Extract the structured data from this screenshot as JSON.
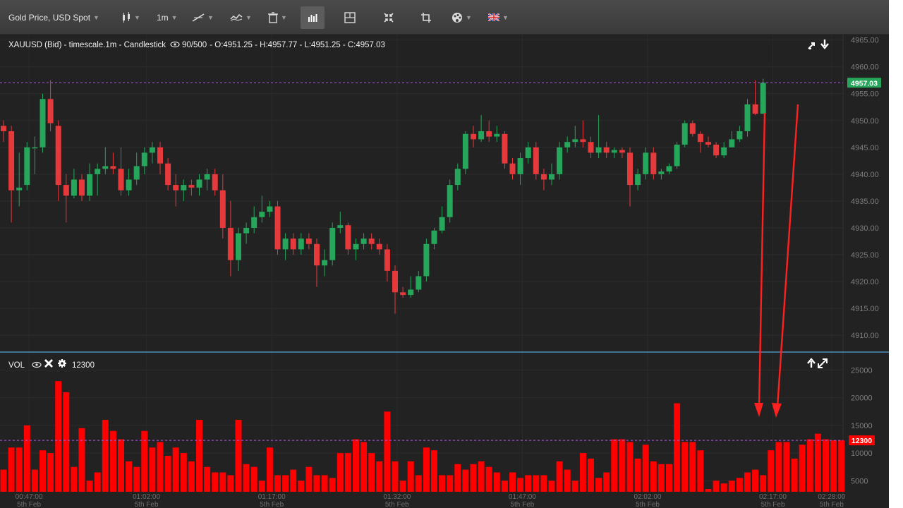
{
  "toolbar": {
    "symbol_label": "Gold Price, USD Spot",
    "timeframe_label": "1m"
  },
  "price_panel": {
    "header": "XAUUSD (Bid) - timescale.1m - Candlestick",
    "visible_count": "90/500",
    "ohlc": "- O:4951.25 - H:4957.77 - L:4951.25 - C:4957.03",
    "last_price_label": "4957.03"
  },
  "volume_panel": {
    "name": "VOL",
    "value": "12300",
    "last_value_label": "12300"
  },
  "colors": {
    "up": "#26a65b",
    "down": "#e5393c",
    "volume": "#ff0000",
    "last_line": "#a45ed6",
    "separator": "#5aa6d9",
    "arrow": "#ff2020"
  },
  "chart_data": [
    {
      "type": "candlestick",
      "title": "XAUUSD (Bid) - timescale.1m - Candlestick",
      "ylim": [
        4907,
        4966
      ],
      "yticks": [
        4910,
        4915,
        4920,
        4925,
        4930,
        4935,
        4940,
        4945,
        4950,
        4955,
        4960,
        4965
      ],
      "ytick_labels": [
        "4910.00",
        "4915.00",
        "4920.00",
        "4925.00",
        "4930.00",
        "4935.00",
        "4940.00",
        "4945.00",
        "4950.00",
        "4955.00",
        "4960.00",
        "4965.00"
      ],
      "last_price": 4957.03,
      "candles": [
        [
          4949.0,
          4950.0,
          4946.0,
          4948.0
        ],
        [
          4948.0,
          4949.0,
          4931.0,
          4937.0
        ],
        [
          4937.0,
          4944.0,
          4934.0,
          4937.5
        ],
        [
          4938.0,
          4946.0,
          4937.0,
          4945.0
        ],
        [
          4945.0,
          4947.0,
          4940.0,
          4945.0
        ],
        [
          4945.0,
          4955.0,
          4944.0,
          4954.0
        ],
        [
          4954.0,
          4957.5,
          4948.0,
          4949.5
        ],
        [
          4949.0,
          4950.0,
          4935.0,
          4938.0
        ],
        [
          4938.0,
          4940.0,
          4931.0,
          4936.0
        ],
        [
          4936.0,
          4941.0,
          4935.5,
          4939.0
        ],
        [
          4939.0,
          4940.0,
          4935.0,
          4936.0
        ],
        [
          4936.0,
          4942.0,
          4935.0,
          4940.0
        ],
        [
          4940.0,
          4942.0,
          4936.0,
          4941.0
        ],
        [
          4941.0,
          4945.0,
          4940.0,
          4941.5
        ],
        [
          4941.5,
          4944.0,
          4940.0,
          4941.0
        ],
        [
          4941.0,
          4945.0,
          4936.0,
          4937.0
        ],
        [
          4937.0,
          4941.0,
          4936.0,
          4939.0
        ],
        [
          4939.0,
          4944.0,
          4938.0,
          4941.5
        ],
        [
          4941.5,
          4945.0,
          4940.0,
          4944.0
        ],
        [
          4944.0,
          4946.0,
          4942.0,
          4945.0
        ],
        [
          4945.0,
          4946.0,
          4940.0,
          4942.0
        ],
        [
          4942.0,
          4943.0,
          4937.0,
          4938.0
        ],
        [
          4938.0,
          4940.0,
          4934.0,
          4937.0
        ],
        [
          4937.0,
          4939.0,
          4935.0,
          4938.0
        ],
        [
          4938.0,
          4939.0,
          4936.0,
          4937.5
        ],
        [
          4937.5,
          4940.0,
          4936.0,
          4939.0
        ],
        [
          4939.0,
          4941.0,
          4937.0,
          4940.0
        ],
        [
          4940.0,
          4941.0,
          4936.0,
          4937.0
        ],
        [
          4937.0,
          4940.0,
          4928.0,
          4930.0
        ],
        [
          4930.0,
          4935.0,
          4921.0,
          4924.0
        ],
        [
          4924.0,
          4930.0,
          4922.0,
          4929.0
        ],
        [
          4929.0,
          4931.0,
          4927.0,
          4930.0
        ],
        [
          4930.0,
          4934.0,
          4929.0,
          4932.0
        ],
        [
          4932.0,
          4936.0,
          4931.0,
          4933.0
        ],
        [
          4933.0,
          4935.0,
          4932.0,
          4934.0
        ],
        [
          4934.0,
          4935.0,
          4925.0,
          4926.0
        ],
        [
          4926.0,
          4929.0,
          4924.0,
          4928.0
        ],
        [
          4928.0,
          4929.0,
          4925.0,
          4926.0
        ],
        [
          4926.0,
          4929.0,
          4925.0,
          4928.0
        ],
        [
          4928.0,
          4929.0,
          4926.0,
          4927.0
        ],
        [
          4927.0,
          4928.0,
          4919.0,
          4923.0
        ],
        [
          4923.0,
          4926.0,
          4921.0,
          4924.0
        ],
        [
          4924.0,
          4931.0,
          4923.0,
          4930.0
        ],
        [
          4930.0,
          4933.0,
          4929.0,
          4930.5
        ],
        [
          4930.5,
          4931.0,
          4925.0,
          4926.0
        ],
        [
          4926.0,
          4928.0,
          4924.0,
          4927.0
        ],
        [
          4927.0,
          4929.0,
          4926.0,
          4928.0
        ],
        [
          4928.0,
          4929.0,
          4926.0,
          4927.0
        ],
        [
          4927.0,
          4928.0,
          4925.0,
          4926.0
        ],
        [
          4926.0,
          4927.0,
          4920.0,
          4922.0
        ],
        [
          4922.0,
          4923.0,
          4914.0,
          4918.0
        ],
        [
          4918.0,
          4919.0,
          4917.0,
          4917.5
        ],
        [
          4917.5,
          4921.0,
          4917.0,
          4918.5
        ],
        [
          4918.5,
          4922.0,
          4918.0,
          4921.0
        ],
        [
          4921.0,
          4928.0,
          4920.0,
          4927.0
        ],
        [
          4927.0,
          4930.0,
          4926.0,
          4929.5
        ],
        [
          4929.5,
          4934.0,
          4929.0,
          4932.0
        ],
        [
          4932.0,
          4939.0,
          4931.0,
          4938.0
        ],
        [
          4938.0,
          4942.0,
          4937.0,
          4941.0
        ],
        [
          4941.0,
          4948.0,
          4940.0,
          4947.5
        ],
        [
          4947.5,
          4949.0,
          4945.0,
          4946.5
        ],
        [
          4946.5,
          4951.0,
          4946.0,
          4948.0
        ],
        [
          4948.0,
          4950.0,
          4946.0,
          4947.0
        ],
        [
          4947.0,
          4949.0,
          4946.0,
          4947.5
        ],
        [
          4947.5,
          4948.0,
          4941.0,
          4942.0
        ],
        [
          4942.0,
          4943.0,
          4939.0,
          4940.0
        ],
        [
          4940.0,
          4944.0,
          4938.0,
          4943.0
        ],
        [
          4943.0,
          4946.0,
          4942.0,
          4945.0
        ],
        [
          4945.0,
          4946.0,
          4939.0,
          4940.0
        ],
        [
          4940.0,
          4941.0,
          4937.0,
          4939.0
        ],
        [
          4939.0,
          4942.0,
          4938.0,
          4940.0
        ],
        [
          4940.0,
          4946.0,
          4939.0,
          4945.0
        ],
        [
          4945.0,
          4947.0,
          4944.0,
          4946.0
        ],
        [
          4946.0,
          4949.0,
          4945.0,
          4946.5
        ],
        [
          4946.5,
          4950.0,
          4945.0,
          4946.0
        ],
        [
          4946.0,
          4947.0,
          4943.0,
          4944.0
        ],
        [
          4944.0,
          4951.0,
          4943.0,
          4945.0
        ],
        [
          4945.0,
          4946.0,
          4943.0,
          4944.0
        ],
        [
          4944.0,
          4945.0,
          4943.0,
          4944.5
        ],
        [
          4944.5,
          4945.0,
          4943.0,
          4944.0
        ],
        [
          4944.0,
          4945.0,
          4934.0,
          4938.0
        ],
        [
          4938.0,
          4941.0,
          4937.0,
          4940.0
        ],
        [
          4940.0,
          4945.0,
          4939.0,
          4944.0
        ],
        [
          4944.0,
          4945.0,
          4939.0,
          4940.0
        ],
        [
          4940.0,
          4941.0,
          4939.0,
          4940.5
        ],
        [
          4940.5,
          4942.0,
          4940.0,
          4941.5
        ],
        [
          4941.5,
          4946.0,
          4941.0,
          4945.5
        ],
        [
          4945.5,
          4950.0,
          4945.0,
          4949.5
        ],
        [
          4949.5,
          4950.0,
          4947.0,
          4947.5
        ],
        [
          4947.5,
          4948.0,
          4944.0,
          4946.0
        ],
        [
          4946.0,
          4947.0,
          4945.0,
          4945.5
        ],
        [
          4945.5,
          4946.0,
          4943.0,
          4943.5
        ],
        [
          4943.5,
          4946.0,
          4943.0,
          4945.0
        ],
        [
          4945.0,
          4948.0,
          4945.0,
          4946.5
        ],
        [
          4946.5,
          4949.0,
          4946.0,
          4948.0
        ],
        [
          4948.0,
          4954.0,
          4947.0,
          4953.0
        ],
        [
          4953.0,
          4957.5,
          4951.0,
          4951.25
        ],
        [
          4951.25,
          4957.77,
          4951.25,
          4957.03
        ]
      ]
    },
    {
      "type": "bar",
      "title": "VOL",
      "ylim": [
        3000,
        28000
      ],
      "yticks": [
        5000,
        10000,
        15000,
        20000,
        25000
      ],
      "ytick_labels": [
        "5000",
        "10000",
        "15000",
        "20000",
        "25000"
      ],
      "last_value": 12300,
      "values": [
        7000,
        11000,
        11000,
        15000,
        7000,
        10500,
        10000,
        23000,
        21000,
        7500,
        14500,
        5000,
        6500,
        16000,
        14000,
        12500,
        8500,
        7500,
        14000,
        11000,
        12000,
        9500,
        11000,
        10000,
        8500,
        16000,
        7500,
        6500,
        6500,
        6000,
        16000,
        8000,
        7500,
        5000,
        11000,
        6000,
        6000,
        7000,
        5000,
        7500,
        6000,
        6000,
        5500,
        10000,
        10000,
        12500,
        12000,
        10000,
        8500,
        17500,
        8500,
        5000,
        8500,
        6000,
        11000,
        10500,
        6000,
        6000,
        8000,
        7000,
        8000,
        8500,
        7500,
        6500,
        5000,
        6500,
        5500,
        6000,
        6000,
        6000,
        5000,
        8500,
        7000,
        5000,
        10000,
        9000,
        5500,
        6500,
        12500,
        12500,
        12000,
        9000,
        11500,
        8500,
        8000,
        8000,
        19000,
        12000,
        12000,
        10500,
        3500,
        5000,
        4500,
        5000,
        5500,
        6500,
        7000,
        6000,
        10500,
        12000,
        12000,
        9000,
        11500,
        12500,
        13500,
        12500,
        12300,
        12300
      ],
      "xtick_labels": [
        "00:47:00",
        "01:02:00",
        "01:17:00",
        "01:32:00",
        "01:47:00",
        "02:02:00",
        "02:17:00",
        "02:28:00"
      ],
      "xtick_sublabels": [
        "5th Feb",
        "5th Feb",
        "5th Feb",
        "5th Feb",
        "5th Feb",
        "5th Feb",
        "5th Feb",
        "5th Feb"
      ]
    }
  ]
}
